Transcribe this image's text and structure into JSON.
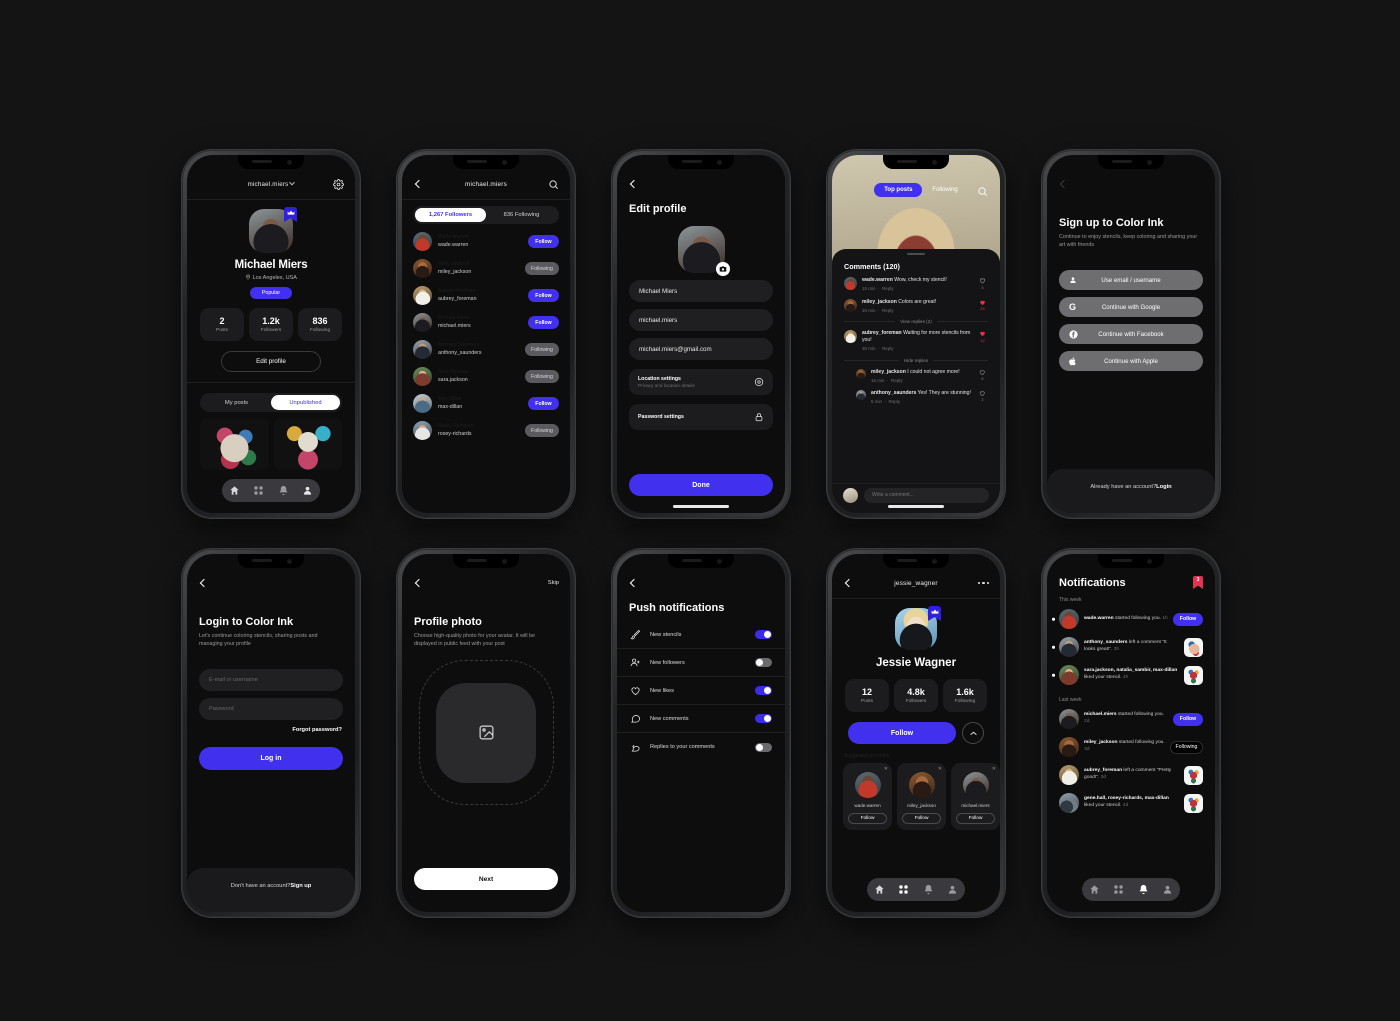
{
  "meta": {
    "canvas_bg": "#141414",
    "accent": "#4130ee",
    "like_red": "#e0344f"
  },
  "profile": {
    "header_title": "michael.miers",
    "name": "Michael Miers",
    "location": "Los Angeles, USA",
    "badge": "Popular",
    "stats": [
      {
        "value": "2",
        "label": "Posts"
      },
      {
        "value": "1.2k",
        "label": "Followers"
      },
      {
        "value": "836",
        "label": "Following"
      }
    ],
    "edit_label": "Edit profile",
    "tabs": [
      {
        "label": "My posts",
        "active": false
      },
      {
        "label": "Unpublished",
        "active": true
      }
    ]
  },
  "followers": {
    "header_title": "michael.miers",
    "tabs": [
      {
        "label": "1,267 Followers",
        "active": true
      },
      {
        "label": "836 Following",
        "active": false
      }
    ],
    "rows": [
      {
        "name": "Wade Warren",
        "username": "wade.warren",
        "action": "Follow",
        "state": "follow",
        "photo": "p-wade"
      },
      {
        "name": "Miley Jackson",
        "username": "miley_jackson",
        "action": "Following",
        "state": "following",
        "photo": "p-miley"
      },
      {
        "name": "Aubrey Foreman",
        "username": "aubrey_foreman",
        "action": "Follow",
        "state": "follow",
        "photo": "p-aubrey"
      },
      {
        "name": "Michael Miers",
        "username": "michael.miers",
        "action": "Follow",
        "state": "follow",
        "photo": "p-michael"
      },
      {
        "name": "Anthony Saunders",
        "username": "anthony_saunders",
        "action": "Following",
        "state": "following",
        "photo": "p-anthony"
      },
      {
        "name": "Sara Jackson",
        "username": "sara.jackson",
        "action": "Following",
        "state": "following",
        "photo": "p-sara"
      },
      {
        "name": "Max Dillan",
        "username": "max-dillan",
        "action": "Follow",
        "state": "follow",
        "photo": "p-max"
      },
      {
        "name": "Rosey Richards",
        "username": "rosey-richards",
        "action": "Following",
        "state": "following",
        "photo": "p-rosey"
      }
    ]
  },
  "edit_profile": {
    "title": "Edit profile",
    "fields": [
      {
        "value": "Michael Miers"
      },
      {
        "value": "michael.miers"
      },
      {
        "value": "michael.miers@gmail.com"
      }
    ],
    "rows": [
      {
        "title": "Location settings",
        "sub": "Privacy and location details",
        "icon": "location-icon"
      },
      {
        "title": "Password settings",
        "sub": "",
        "icon": "lock-icon"
      }
    ],
    "done_label": "Done"
  },
  "feed": {
    "tabs": [
      {
        "label": "Top posts",
        "active": true
      },
      {
        "label": "Following",
        "active": false
      }
    ],
    "comments_title": "Comments (120)",
    "comments": [
      {
        "user": "wade.warren",
        "text": "Wow, check my stencil!",
        "time": "15 min",
        "reply": "Reply",
        "likes": "5",
        "liked": false,
        "photo": "p-wade",
        "indent": false
      },
      {
        "user": "miley_jackson",
        "text": "Colors are great!",
        "time": "20 min",
        "reply": "Reply",
        "likes": "25",
        "liked": true,
        "photo": "p-miley",
        "indent": false
      },
      {
        "divider": "View replies (2)"
      },
      {
        "user": "aubrey_foreman",
        "text": "Waiting for more stencils from you!",
        "time": "30 min",
        "reply": "Reply",
        "likes": "12",
        "liked": true,
        "photo": "p-aubrey",
        "indent": false
      },
      {
        "divider": "Hide replies"
      },
      {
        "user": "miley_jackson",
        "text": "I could not agree more!",
        "time": "16 min",
        "reply": "Reply",
        "likes": "8",
        "liked": false,
        "photo": "p-miley",
        "indent": true
      },
      {
        "user": "anthony_saunders",
        "text": "Yes! They are stunning!",
        "time": "5 min",
        "reply": "Reply",
        "likes": "2",
        "liked": false,
        "photo": "p-anthony",
        "indent": true
      }
    ],
    "composer_placeholder": "Write a comment..."
  },
  "signup": {
    "title": "Sign up to Color Ink",
    "subtitle": "Continue to enjoy stencils, keep coloring and sharing your art with friends",
    "buttons": [
      {
        "label": "Use email / username",
        "icon": "person-icon"
      },
      {
        "label": "Continue with Google",
        "icon": "google-icon"
      },
      {
        "label": "Continue with Facebook",
        "icon": "facebook-icon"
      },
      {
        "label": "Continue with Apple",
        "icon": "apple-icon"
      }
    ],
    "footer_text": "Already have an account? ",
    "footer_link": "Login"
  },
  "login": {
    "title": "Login to Color Ink",
    "subtitle": "Let's continue coloring stencils, sharing posts and managing your profile",
    "email_placeholder": "E-mail or username",
    "password_placeholder": "Password",
    "forgot": "Forgot password?",
    "submit": "Log in",
    "footer_text": "Don't have an account? ",
    "footer_link": "Sign up"
  },
  "photo": {
    "skip": "Skip",
    "title": "Profile photo",
    "subtitle": "Choose high-quality photo for your avatar. It will be displayed in public feed with your post",
    "next": "Next"
  },
  "push": {
    "title": "Push notifications",
    "rows": [
      {
        "label": "New stencils",
        "icon": "brush-icon",
        "on": true
      },
      {
        "label": "New followers",
        "icon": "add-person-icon",
        "on": false
      },
      {
        "label": "New likes",
        "icon": "heart-icon",
        "on": true
      },
      {
        "label": "New comments",
        "icon": "comment-icon",
        "on": true
      },
      {
        "label": "Replies to your comments",
        "icon": "reply-icon",
        "on": false
      }
    ]
  },
  "jessie": {
    "header_title": "jessie_wagner",
    "name": "Jessie Wagner",
    "stats": [
      {
        "value": "12",
        "label": "Posts"
      },
      {
        "value": "4.8k",
        "label": "Followers"
      },
      {
        "value": "1.6k",
        "label": "Following"
      }
    ],
    "follow_label": "Follow",
    "suggested_title": "Suggested accounts",
    "suggested": [
      {
        "username": "wade.warren",
        "action": "Follow",
        "photo": "p-wade"
      },
      {
        "username": "miley_jackson",
        "action": "Follow",
        "photo": "p-miley"
      },
      {
        "username": "michael.miers",
        "action": "Follow",
        "photo": "p-michael"
      }
    ]
  },
  "notifications": {
    "title": "Notifications",
    "badge_count": "3",
    "groups": [
      {
        "label": "This week",
        "items": [
          {
            "user": "wade.warren",
            "text": " started following you. ",
            "time": "1h",
            "unread": true,
            "photo": "p-wade",
            "right": "follow",
            "right_label": "Follow"
          },
          {
            "user": "anthony_saunders",
            "text": " left a comment “It looks great!”. ",
            "time": "3h",
            "unread": true,
            "photo": "p-anthony",
            "right": "thumb",
            "thumb": "stencil-hand"
          },
          {
            "user": "sara.jackson, natalia_sambir, max-dillan",
            "text": " liked your stencil. ",
            "time": "4h",
            "unread": true,
            "photo": "p-sara",
            "right": "thumb",
            "thumb": "stencil-red"
          }
        ]
      },
      {
        "label": "Last week",
        "items": [
          {
            "user": "michael.miers",
            "text": " started following you. ",
            "time": "2d",
            "unread": false,
            "photo": "p-michael",
            "right": "follow",
            "right_label": "Follow"
          },
          {
            "user": "miley_jackson",
            "text": " started following you. ",
            "time": "3d",
            "unread": false,
            "photo": "p-miley",
            "right": "following",
            "right_label": "Following"
          },
          {
            "user": "aubrey_foreman",
            "text": " left a comment “Pretty good!”. ",
            "time": "3d",
            "unread": false,
            "photo": "p-aubrey",
            "right": "thumb",
            "thumb": "stencil-red"
          },
          {
            "user": "gene.hall, rosey-richards, max-dillan",
            "text": " liked your stencil. ",
            "time": "4d",
            "unread": false,
            "photo": "p-gene",
            "right": "thumb",
            "thumb": "stencil-red"
          }
        ]
      }
    ]
  },
  "tabbar": {
    "items": [
      "home-icon",
      "grid-icon",
      "bell-icon",
      "person-icon"
    ]
  }
}
